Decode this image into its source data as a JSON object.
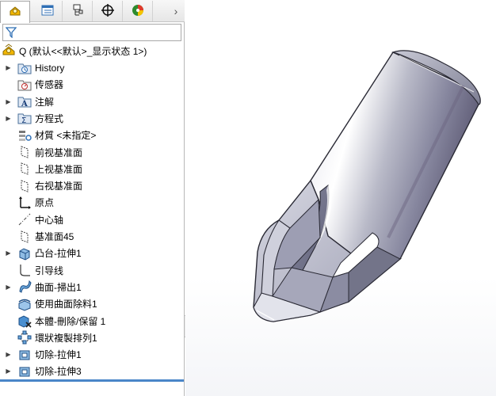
{
  "tabs": [
    {
      "name": "feature-manager-tab",
      "icon": "feature-manager-icon",
      "active": true
    },
    {
      "name": "property-manager-tab",
      "icon": "property-manager-icon",
      "active": false
    },
    {
      "name": "configuration-manager-tab",
      "icon": "configuration-manager-icon",
      "active": false
    },
    {
      "name": "dimxpert-manager-tab",
      "icon": "dimxpert-icon",
      "active": false
    },
    {
      "name": "display-manager-tab",
      "icon": "display-manager-icon",
      "active": false
    }
  ],
  "expand_glyph": "›",
  "filter": {
    "icon": "filter-icon",
    "value": ""
  },
  "root": {
    "label": "Q  (默认<<默认>_显示状态 1>)",
    "icon": "part-icon"
  },
  "tree": [
    {
      "label": "History",
      "icon": "history-folder-icon",
      "expandable": true
    },
    {
      "label": "传感器",
      "icon": "sensors-icon",
      "expandable": false
    },
    {
      "label": "注解",
      "icon": "annotations-icon",
      "expandable": true
    },
    {
      "label": "方程式",
      "icon": "equations-icon",
      "expandable": true
    },
    {
      "label": "材質 <未指定>",
      "icon": "material-icon",
      "expandable": false
    },
    {
      "label": "前视基准面",
      "icon": "plane-icon",
      "expandable": false
    },
    {
      "label": "上视基准面",
      "icon": "plane-icon",
      "expandable": false
    },
    {
      "label": "右视基准面",
      "icon": "plane-icon",
      "expandable": false
    },
    {
      "label": "原点",
      "icon": "origin-icon",
      "expandable": false
    },
    {
      "label": "中心轴",
      "icon": "axis-icon",
      "expandable": false
    },
    {
      "label": "基准面45",
      "icon": "plane-icon",
      "expandable": false
    },
    {
      "label": "凸台-拉伸1",
      "icon": "boss-extrude-icon",
      "expandable": true
    },
    {
      "label": "引导线",
      "icon": "sketch-icon",
      "expandable": false
    },
    {
      "label": "曲面-掃出1",
      "icon": "surface-sweep-icon",
      "expandable": true
    },
    {
      "label": "使用曲面除料1",
      "icon": "surface-cut-icon",
      "expandable": false
    },
    {
      "label": "本體-刪除/保留 1",
      "icon": "body-delete-icon",
      "expandable": false
    },
    {
      "label": "環狀複製排列1",
      "icon": "circular-pattern-icon",
      "expandable": false
    },
    {
      "label": "切除-拉伸1",
      "icon": "cut-extrude-icon",
      "expandable": true
    },
    {
      "label": "切除-拉伸3",
      "icon": "cut-extrude-icon",
      "expandable": true
    }
  ],
  "colors": {
    "accent": "#4a86c8",
    "icon_blue": "#2f6fb5",
    "part_yellow": "#f2b700"
  }
}
